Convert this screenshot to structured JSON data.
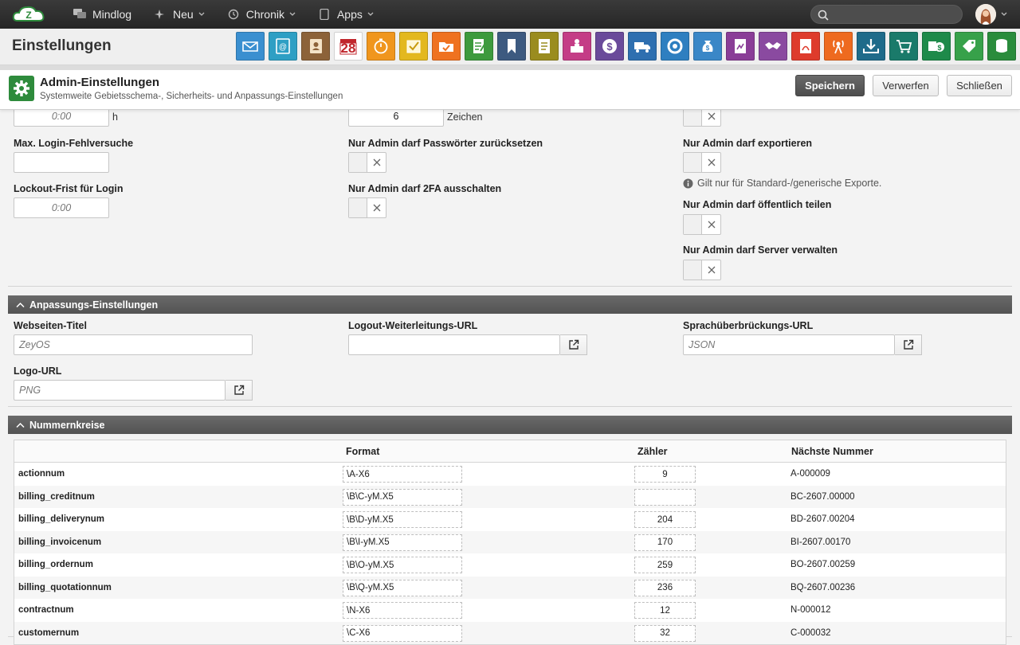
{
  "topbar": {
    "items": [
      {
        "label": "Mindlog",
        "icon": "chat-icon",
        "has_dropdown": false
      },
      {
        "label": "Neu",
        "icon": "sparkle-icon",
        "has_dropdown": true
      },
      {
        "label": "Chronik",
        "icon": "history-icon",
        "has_dropdown": true
      },
      {
        "label": "Apps",
        "icon": "tablet-icon",
        "has_dropdown": true
      }
    ]
  },
  "appbar": {
    "title": "Einstellungen",
    "icons": [
      {
        "name": "mail-app-icon",
        "color": "#3a8fd0"
      },
      {
        "name": "contacts-email-app-icon",
        "color": "#2e9fc4"
      },
      {
        "name": "addressbook-app-icon",
        "color": "#8c6239"
      },
      {
        "name": "calendar-app-icon",
        "color": "#c0262c",
        "text": "28"
      },
      {
        "name": "timer-app-icon",
        "color": "#f0961e"
      },
      {
        "name": "tasks-app-icon",
        "color": "#e3b81f"
      },
      {
        "name": "projects-app-icon",
        "color": "#ef7220"
      },
      {
        "name": "notes-app-icon",
        "color": "#3d9a3d"
      },
      {
        "name": "bookmarks-app-icon",
        "color": "#3d5a80"
      },
      {
        "name": "documents-app-icon",
        "color": "#9a8c1f"
      },
      {
        "name": "reception-app-icon",
        "color": "#c43d86"
      },
      {
        "name": "finance-app-icon",
        "color": "#6a4a9a"
      },
      {
        "name": "delivery-app-icon",
        "color": "#2e6fb0"
      },
      {
        "name": "support-app-icon",
        "color": "#2e7fc0"
      },
      {
        "name": "payments-app-icon",
        "color": "#3a87c7"
      },
      {
        "name": "contracts-app-icon",
        "color": "#8a3d97"
      },
      {
        "name": "partners-app-icon",
        "color": "#8a4aa0"
      },
      {
        "name": "pdf-app-icon",
        "color": "#de3b2c"
      },
      {
        "name": "broadcast-app-icon",
        "color": "#ee6a1f"
      },
      {
        "name": "download-app-icon",
        "color": "#1f6b8a"
      },
      {
        "name": "shop-app-icon",
        "color": "#1a7a6a"
      },
      {
        "name": "accounting-app-icon",
        "color": "#1e8a4a"
      },
      {
        "name": "pricetags-app-icon",
        "color": "#37a14a"
      },
      {
        "name": "database-app-icon",
        "color": "#2a8c3c"
      }
    ]
  },
  "dialog": {
    "title": "Admin-Einstellungen",
    "subtitle": "Systemweite Gebietsschema-, Sicherheits- und Anpassungs-Einstellungen",
    "save_label": "Speichern",
    "discard_label": "Verwerfen",
    "close_label": "Schließen"
  },
  "security": {
    "top_duration_placeholder": "0:00",
    "top_duration_unit": "h",
    "top_chars_value": "6",
    "top_chars_unit": "Zeichen",
    "max_login_label": "Max. Login-Fehlversuche",
    "max_login_value": "",
    "lockout_label": "Lockout-Frist für Login",
    "lockout_placeholder": "0:00",
    "admin_reset_pw_label": "Nur Admin darf Passwörter zurücksetzen",
    "admin_2fa_label": "Nur Admin darf 2FA ausschalten",
    "admin_export_label": "Nur Admin darf exportieren",
    "admin_export_hint": "Gilt nur für Standard-/generische Exporte.",
    "admin_share_label": "Nur Admin darf öffentlich teilen",
    "admin_server_label": "Nur Admin darf Server verwalten"
  },
  "customization": {
    "header": "Anpassungs-Einstellungen",
    "site_title_label": "Webseiten-Titel",
    "site_title_placeholder": "ZeyOS",
    "logout_url_label": "Logout-Weiterleitungs-URL",
    "logout_url_value": "",
    "lang_url_label": "Sprachüberbrückungs-URL",
    "lang_url_placeholder": "JSON",
    "logo_url_label": "Logo-URL",
    "logo_url_placeholder": "PNG"
  },
  "numbering": {
    "header": "Nummernkreise",
    "columns": {
      "key": "",
      "format": "Format",
      "counter": "Zähler",
      "next": "Nächste Nummer"
    },
    "rows": [
      {
        "key": "actionnum",
        "format": "\\A-X6",
        "counter": "9",
        "next": "A-000009"
      },
      {
        "key": "billing_creditnum",
        "format": "\\B\\C-yM.X5",
        "counter": "",
        "next": "BC-2607.00000"
      },
      {
        "key": "billing_deliverynum",
        "format": "\\B\\D-yM.X5",
        "counter": "204",
        "next": "BD-2607.00204"
      },
      {
        "key": "billing_invoicenum",
        "format": "\\B\\I-yM.X5",
        "counter": "170",
        "next": "BI-2607.00170"
      },
      {
        "key": "billing_ordernum",
        "format": "\\B\\O-yM.X5",
        "counter": "259",
        "next": "BO-2607.00259"
      },
      {
        "key": "billing_quotationnum",
        "format": "\\B\\Q-yM.X5",
        "counter": "236",
        "next": "BQ-2607.00236"
      },
      {
        "key": "contractnum",
        "format": "\\N-X6",
        "counter": "12",
        "next": "N-000012"
      },
      {
        "key": "customernum",
        "format": "\\C-X6",
        "counter": "32",
        "next": "C-000032"
      }
    ]
  }
}
